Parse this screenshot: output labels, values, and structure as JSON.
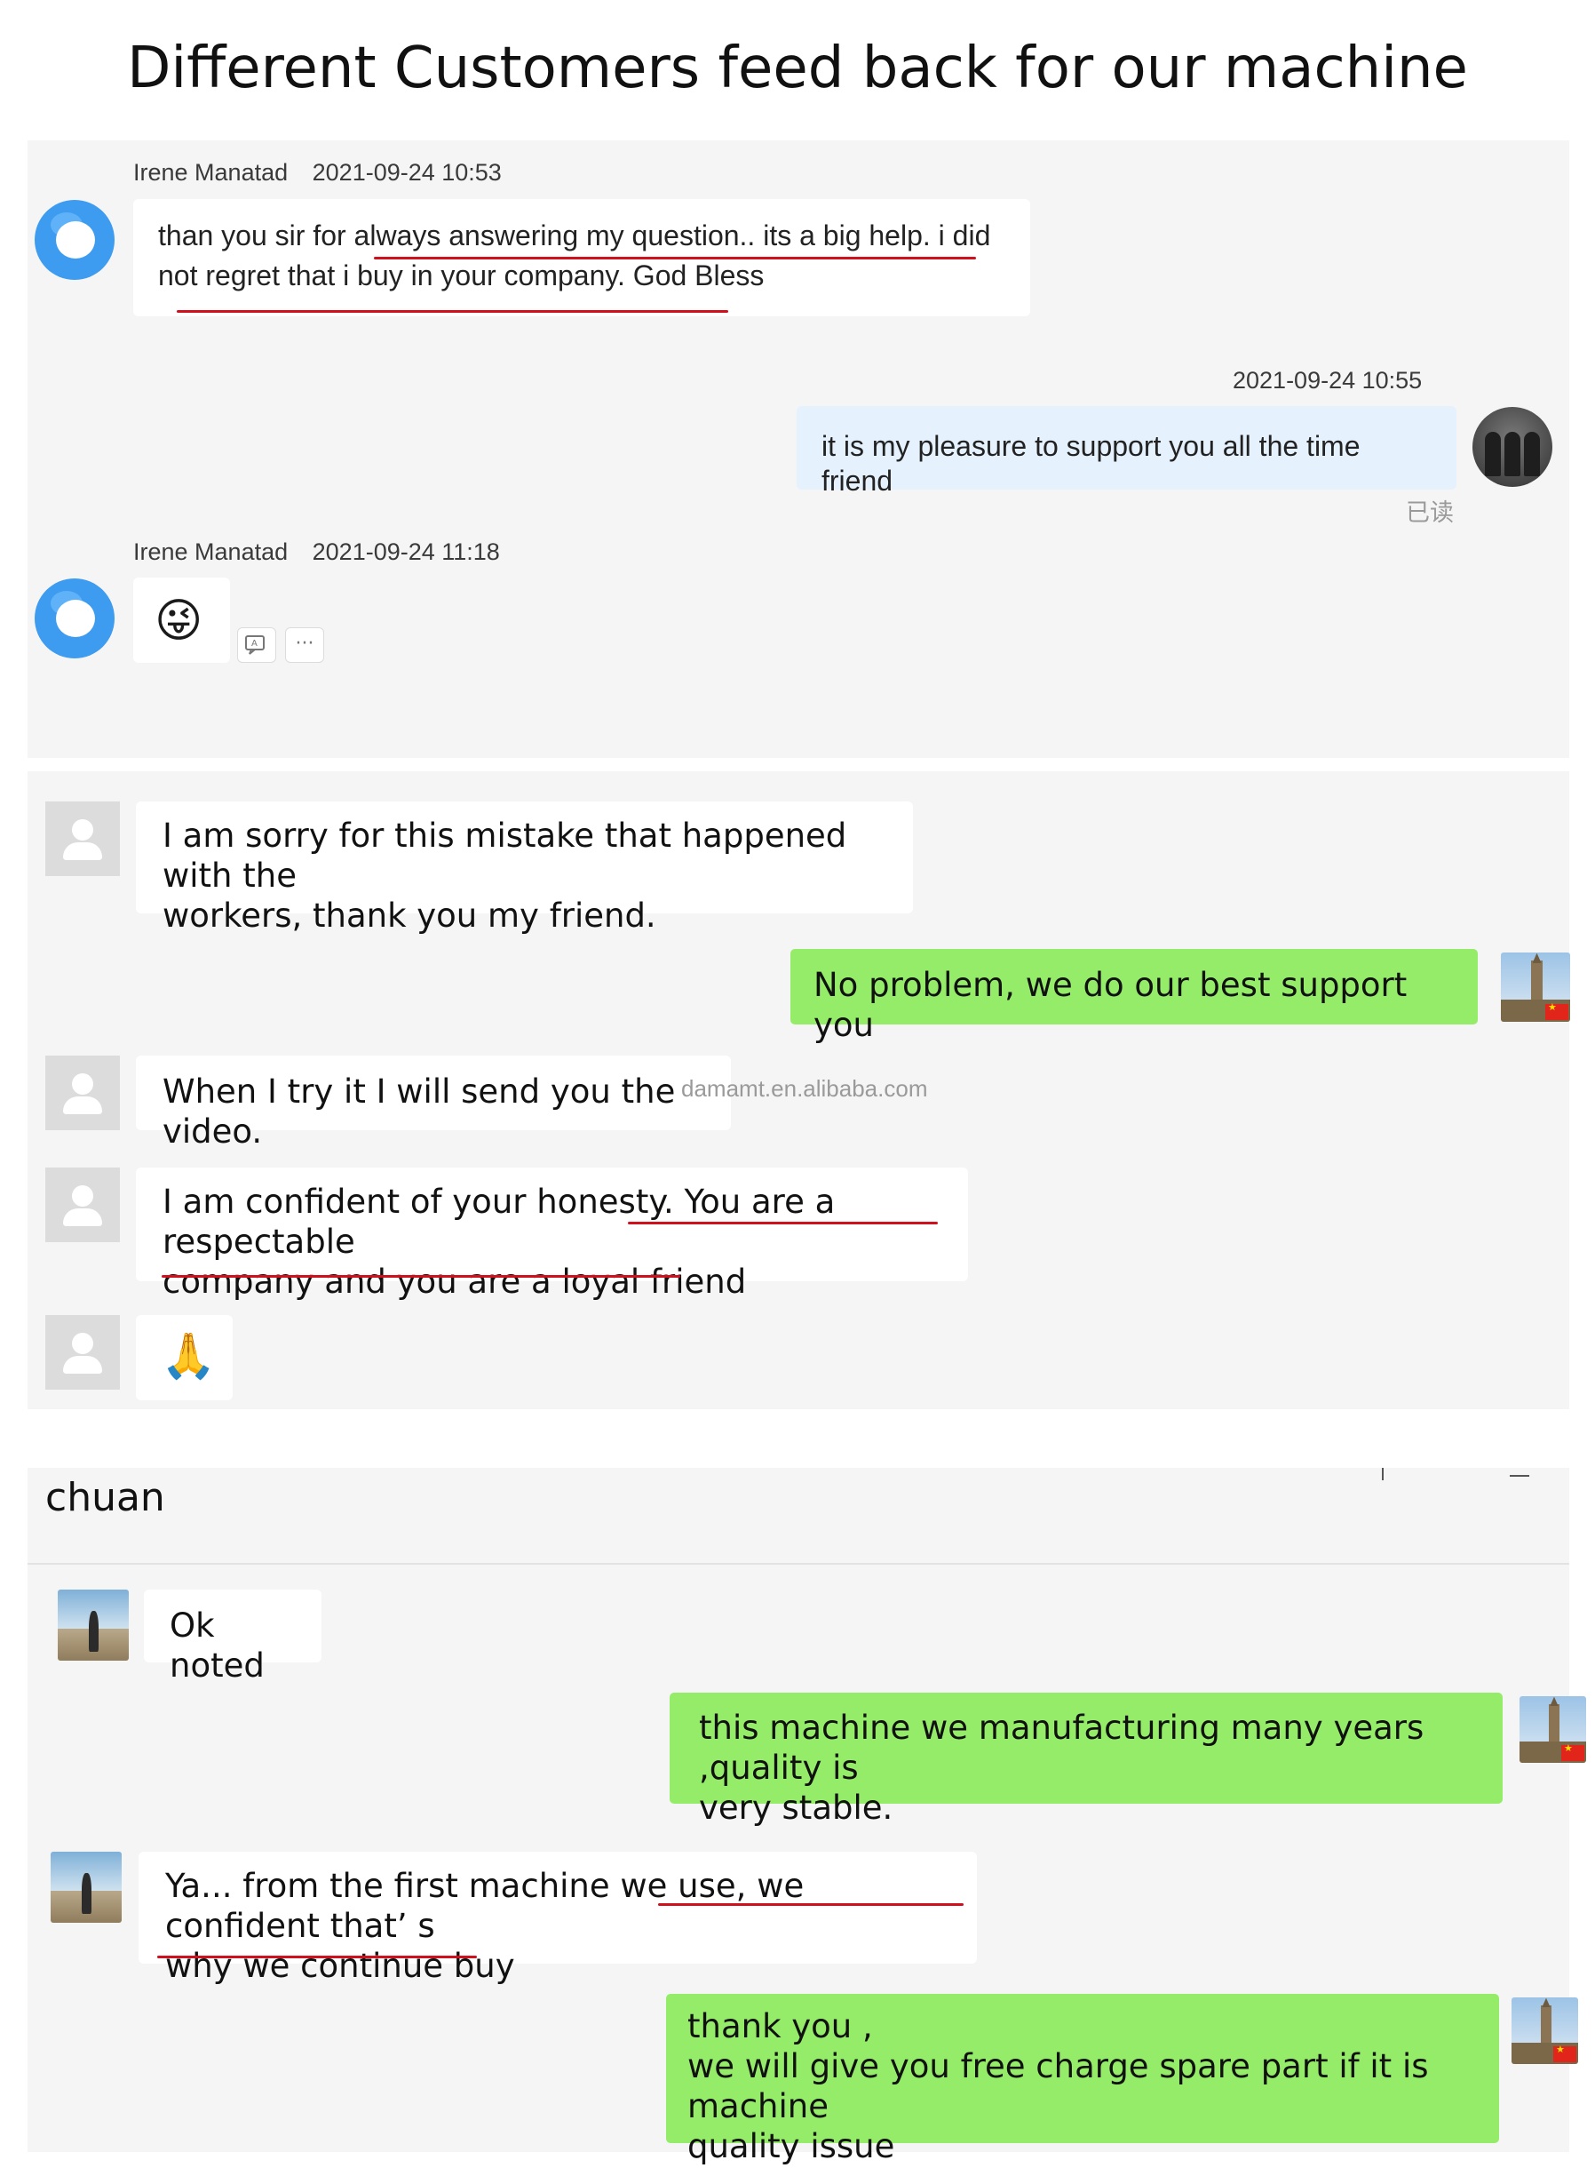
{
  "page_title": "Different Customers feed back for our machine",
  "chat1": {
    "msg1": {
      "sender": "Irene Manatad",
      "time": "2021-09-24 10:53",
      "line1": "than you sir for always answering my question.. its a big help. i did",
      "line2": "not regret that i buy in your company. God Bless"
    },
    "msg2": {
      "time": "2021-09-24 10:55",
      "text": "it is my pleasure to support you all the time friend",
      "read_status": "已读"
    },
    "msg3": {
      "sender": "Irene Manatad",
      "time": "2021-09-24 11:18",
      "emoji": "😜",
      "translate_icon": "translate-icon",
      "more_icon": "more-icon",
      "more_glyph": "···"
    }
  },
  "chat2": {
    "messages": [
      {
        "side": "left",
        "lines": [
          "I am sorry for this mistake that happened with the",
          "workers, thank you my friend."
        ]
      },
      {
        "side": "right",
        "lines": [
          "No problem, we do our best support you"
        ]
      },
      {
        "side": "left",
        "lines": [
          "When I try it I will send you the video."
        ]
      },
      {
        "side": "left",
        "lines": [
          "I am confident of your honesty. You are a respectable",
          "company and you are a loyal friend"
        ]
      },
      {
        "side": "left",
        "lines": [
          "🙏"
        ]
      }
    ],
    "watermark": "damamt.en.alibaba.com"
  },
  "chat3": {
    "contact_name": "chuan",
    "messages": [
      {
        "side": "left",
        "lines": [
          "Ok noted"
        ]
      },
      {
        "side": "right",
        "lines": [
          "this machine we manufacturing many years ,quality is",
          "very stable."
        ]
      },
      {
        "side": "left",
        "lines": [
          "Ya... from the first machine we use, we confident that’ s",
          "why we continue buy"
        ]
      },
      {
        "side": "right",
        "lines": [
          "thank you ,",
          "we will give you free charge spare part if it is machine",
          "quality issue"
        ]
      }
    ]
  },
  "colors": {
    "underline": "#d0101c",
    "wechat_green": "#95ec69",
    "dingtalk_blue": "#3d9bf0",
    "panel_bg": "#f5f5f5"
  }
}
